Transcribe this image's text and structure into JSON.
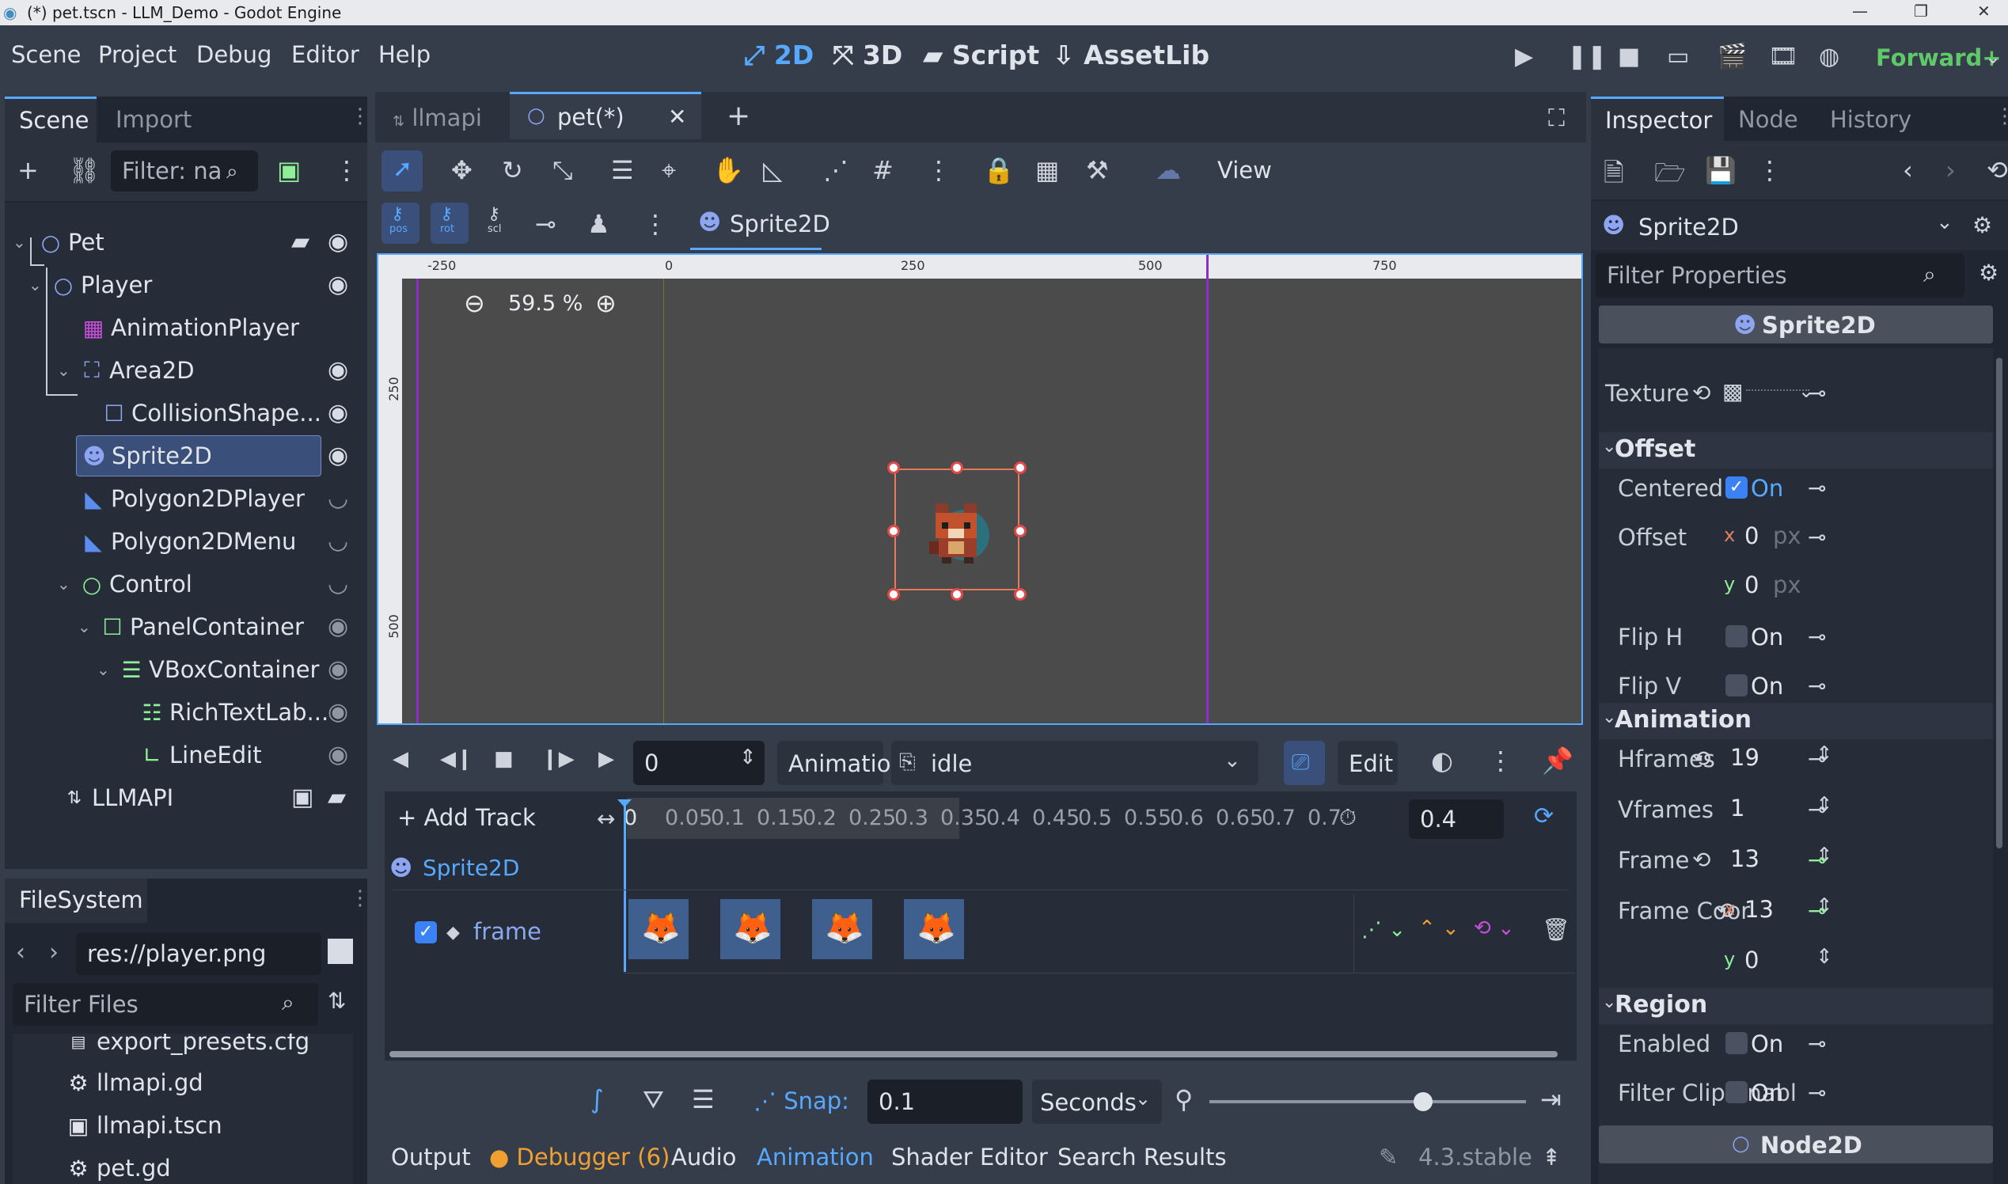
{
  "window": {
    "title": "(*) pet.tscn - LLM_Demo - Godot Engine"
  },
  "menu": [
    "Scene",
    "Project",
    "Debug",
    "Editor",
    "Help"
  ],
  "workspaces": [
    {
      "label": "2D",
      "active": true
    },
    {
      "label": "3D",
      "active": false
    },
    {
      "label": "Script",
      "active": false
    },
    {
      "label": "AssetLib",
      "active": false
    }
  ],
  "renderer": "Forward+",
  "scene_dock": {
    "tabs": [
      "Scene",
      "Import"
    ],
    "filter_placeholder": "Filter: na",
    "nodes": [
      {
        "label": "Pet",
        "icon": "node2d-icon",
        "color": "#8da5f3"
      },
      {
        "label": "Player",
        "icon": "node2d-icon",
        "color": "#8da5f3"
      },
      {
        "label": "AnimationPlayer",
        "icon": "animation-player-icon",
        "color": "#c84fd9"
      },
      {
        "label": "Area2D",
        "icon": "area2d-icon",
        "color": "#8da5f3"
      },
      {
        "label": "CollisionShape...",
        "icon": "collision-shape-icon",
        "color": "#8da5f3"
      },
      {
        "label": "Sprite2D",
        "icon": "sprite2d-icon",
        "color": "#8da5f3"
      },
      {
        "label": "Polygon2DPlayer",
        "icon": "polygon2d-icon",
        "color": "#8da5f3"
      },
      {
        "label": "Polygon2DMenu",
        "icon": "polygon2d-icon",
        "color": "#8da5f3"
      },
      {
        "label": "Control",
        "icon": "control-icon",
        "color": "#8eef97"
      },
      {
        "label": "PanelContainer",
        "icon": "panel-container-icon",
        "color": "#8eef97"
      },
      {
        "label": "VBoxContainer",
        "icon": "vbox-container-icon",
        "color": "#8eef97"
      },
      {
        "label": "RichTextLab...",
        "icon": "rich-text-label-icon",
        "color": "#8eef97"
      },
      {
        "label": "LineEdit",
        "icon": "line-edit-icon",
        "color": "#8eef97"
      },
      {
        "label": "LLMAPI",
        "icon": "http-request-icon",
        "color": "#dfe3ea"
      }
    ]
  },
  "filesystem": {
    "tab": "FileSystem",
    "path": "res://player.png",
    "filter_placeholder": "Filter Files",
    "files": [
      "export_presets.cfg",
      "llmapi.gd",
      "llmapi.tscn",
      "pet.gd"
    ]
  },
  "editor_tabs": [
    {
      "label": "llmapi",
      "active": false
    },
    {
      "label": "pet(*)",
      "active": true
    }
  ],
  "viewport": {
    "toolbar_view": "View",
    "breadcrumb": "Sprite2D",
    "zoom": "59.5 %",
    "ruler_labels": [
      "-250",
      "0",
      "250",
      "500",
      "750"
    ],
    "vruler_labels": [
      "250",
      "500"
    ],
    "snap_modes": [
      "pos",
      "rot",
      "scl"
    ]
  },
  "animation": {
    "time": "0",
    "animation_label": "Animation",
    "animation_name": "idle",
    "edit_label": "Edit",
    "add_track": "Add Track",
    "timeline_ticks": [
      "0",
      "0.05",
      "0.1",
      "0.15",
      "0.2",
      "0.25",
      "0.3",
      "0.35",
      "0.4",
      "0.45",
      "0.5",
      "0.55",
      "0.6",
      "0.65",
      "0.7",
      "0.7"
    ],
    "length": "0.4",
    "track_node": "Sprite2D",
    "track_property": "frame",
    "snap_label": "Snap:",
    "snap_value": "0.1",
    "snap_unit": "Seconds"
  },
  "bottom_tabs": [
    "Output",
    "Debugger (6)",
    "Audio",
    "Animation",
    "Shader Editor",
    "Search Results"
  ],
  "version": "4.3.stable",
  "inspector": {
    "tabs": [
      "Inspector",
      "Node",
      "History"
    ],
    "object": "Sprite2D",
    "filter_placeholder": "Filter Properties",
    "class_header": "Sprite2D",
    "texture_label": "Texture",
    "sections": {
      "offset": "Offset",
      "animation": "Animation",
      "region": "Region"
    },
    "props": {
      "centered": {
        "label": "Centered",
        "value": "On",
        "checked": true
      },
      "offset": {
        "label": "Offset",
        "x": "0",
        "y": "0",
        "unit": "px"
      },
      "flip_h": {
        "label": "Flip H",
        "value": "On",
        "checked": false
      },
      "flip_v": {
        "label": "Flip V",
        "value": "On",
        "checked": false
      },
      "hframes": {
        "label": "Hframes",
        "value": "19"
      },
      "vframes": {
        "label": "Vframes",
        "value": "1"
      },
      "frame": {
        "label": "Frame",
        "value": "13"
      },
      "frame_coords": {
        "label": "Frame Coor",
        "x": "13",
        "y": "0"
      },
      "region_enabled": {
        "label": "Enabled",
        "value": "On",
        "checked": false
      },
      "filter_clip": {
        "label": "Filter Clip Enabl",
        "value": "On",
        "checked": false
      }
    },
    "footer_class": "Node2D",
    "axis_x": "x",
    "axis_y": "y"
  },
  "colors": {
    "accent": "#56a9ff",
    "selection": "#3a4f79",
    "debugger": "#f0a030",
    "guide_purple": "#8b2fc9"
  }
}
